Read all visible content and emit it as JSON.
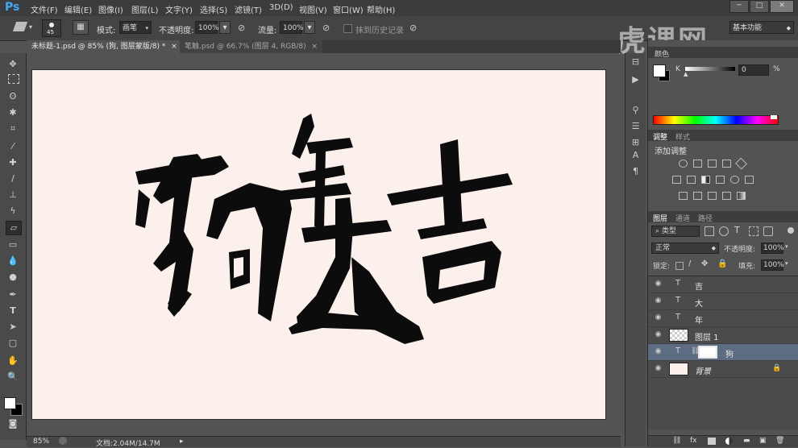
{
  "app": {
    "logo": "Ps"
  },
  "menu": [
    "文件(F)",
    "编辑(E)",
    "图像(I)",
    "图层(L)",
    "文字(Y)",
    "选择(S)",
    "滤镜(T)",
    "3D(D)",
    "视图(V)",
    "窗口(W)",
    "帮助(H)"
  ],
  "window_controls": {
    "minimize": "─",
    "restore": "□",
    "close": "✕"
  },
  "options": {
    "brush_size": "45",
    "mode_label": "模式:",
    "mode_value": "画笔",
    "opacity_label": "不透明度:",
    "opacity_value": "100%",
    "flow_label": "流量:",
    "flow_value": "100%",
    "erase_history_label": "抹到历史记录",
    "workspace_value": "基本功能"
  },
  "tabs": [
    {
      "label": "未标题-1.psd @ 85% (狗, 图层蒙版/8) *",
      "close": "×"
    },
    {
      "label": "笔触.psd @ 66.7% (图层 4, RGB/8)",
      "close": "×"
    }
  ],
  "canvas": {
    "artwork_chars": [
      "狗",
      "年",
      "大",
      "吉"
    ],
    "background_color": "#fcf0ec"
  },
  "status": {
    "zoom": "85%",
    "doc_info": "文档:2.04M/14.7M"
  },
  "watermark": "虎课网",
  "color_panel": {
    "tab": "颜色",
    "channel_label": "K",
    "value": "0",
    "unit": "%"
  },
  "adjust_panel": {
    "tabs": [
      "调整",
      "样式"
    ],
    "title": "添加调整"
  },
  "layers_panel": {
    "tabs": [
      "图层",
      "通道",
      "路径"
    ],
    "filter_label": "类型",
    "blend_mode": "正常",
    "opacity_label": "不透明度:",
    "opacity_value": "100%",
    "lock_label": "锁定:",
    "fill_label": "填充:",
    "fill_value": "100%",
    "layers": [
      {
        "type": "text",
        "name": "吉"
      },
      {
        "type": "text",
        "name": "大"
      },
      {
        "type": "text",
        "name": "年"
      },
      {
        "type": "pixel",
        "name": "图层 1"
      },
      {
        "type": "text-mask",
        "name": "狗",
        "selected": true
      },
      {
        "type": "background",
        "name": "背景"
      }
    ]
  },
  "colors": {
    "accent": "#3fa9f5",
    "selected_layer": "#5d6c82",
    "canvas_bg": "#fcf0ec",
    "ink": "#0c0c0c"
  }
}
